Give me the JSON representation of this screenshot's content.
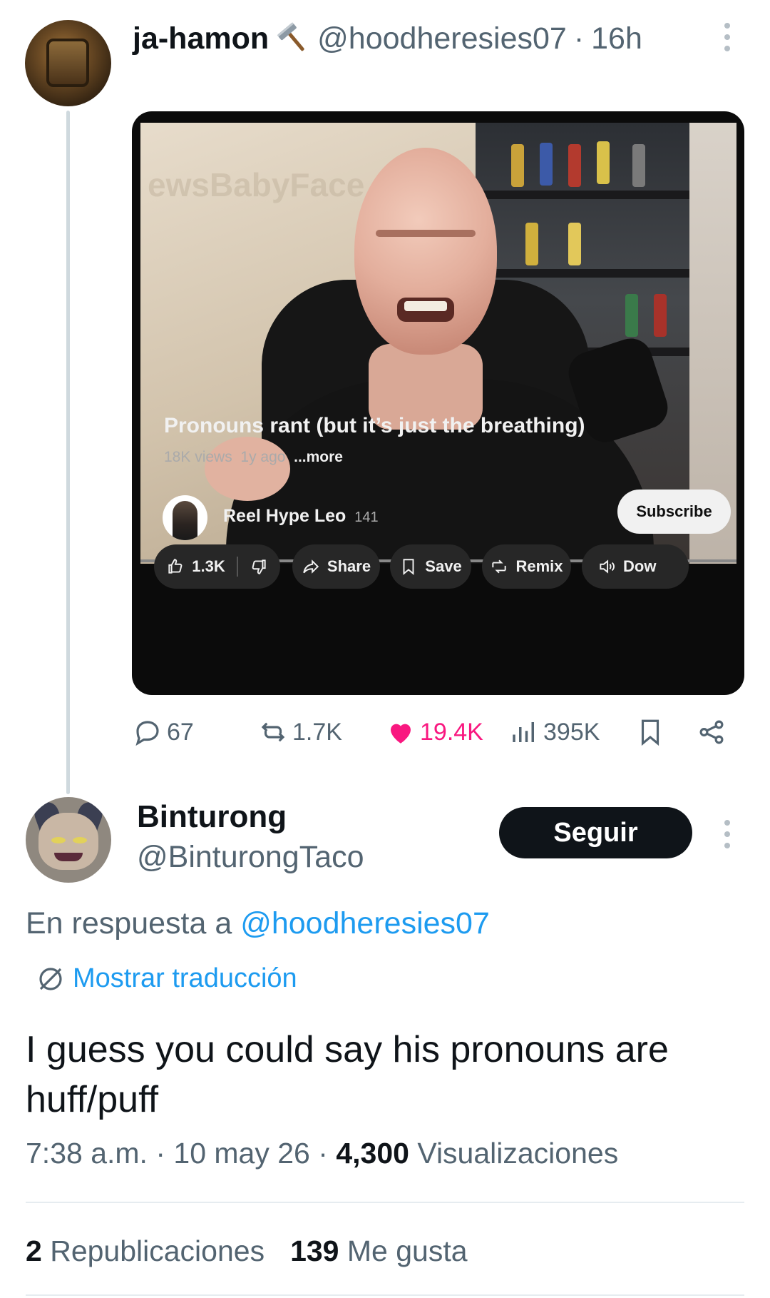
{
  "tweet": {
    "author_name": "ja-hamon",
    "author_handle": "@hoodheresies07",
    "time_ago": "16h",
    "separator": "·",
    "video": {
      "title": "Pronouns rant (but it’s just the breathing)",
      "views": "18K views",
      "age": "1y ago",
      "more": "...more",
      "wall_text": "ewsBabyFace",
      "channel_name": "Reel Hype Leo",
      "channel_subs": "141",
      "subscribe_label": "Subscribe",
      "likes": "1.3K",
      "share_label": "Share",
      "save_label": "Save",
      "remix_label": "Remix",
      "download_label": "Dow"
    },
    "stats": {
      "replies": "67",
      "reposts": "1.7K",
      "likes": "19.4K",
      "views": "395K"
    },
    "colors": {
      "like": "#f91880",
      "muted": "#536471"
    }
  },
  "reply": {
    "author_name": "Binturong",
    "author_handle": "@BinturongTaco",
    "follow_label": "Seguir",
    "reply_prefix": "En respuesta a",
    "reply_to": "@hoodheresies07",
    "translate_label": "Mostrar traducción",
    "text": "I guess you could say his pronouns are huff/puff",
    "time": "7:38 a.m.",
    "date": "10 may 26",
    "separator": "·",
    "views_count": "4,300",
    "views_label": "Visualizaciones",
    "reposts_count": "2",
    "reposts_label": "Republicaciones",
    "likes_count": "139",
    "likes_label": "Me gusta",
    "colors": {
      "link": "#1d9bf0",
      "follow_bg": "#0f1419"
    }
  }
}
